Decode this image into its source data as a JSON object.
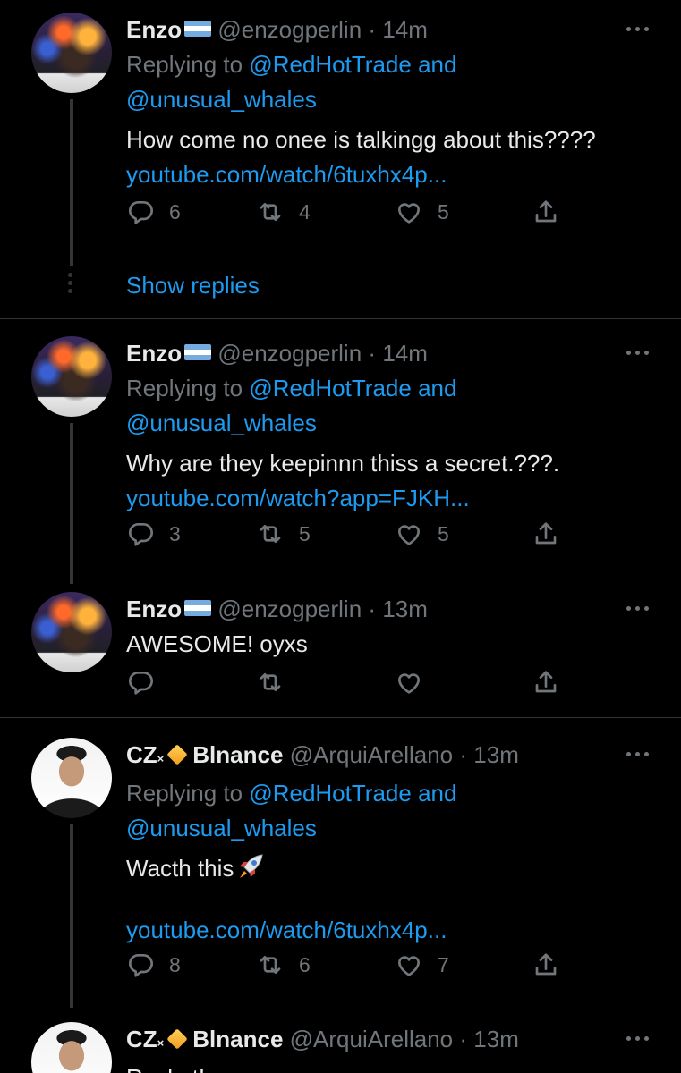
{
  "tweets": [
    {
      "name": "Enzo",
      "handle": "@enzogperlin",
      "dot": "·",
      "time": "14m",
      "replying_prefix": "Replying to",
      "mention1": "@RedHotTrade",
      "and": "and",
      "mention2": "@unusual_whales",
      "text": "How come no onee is talkingg about this????",
      "link": "youtube.com/watch/6tuxhx4p...",
      "replies": "6",
      "retweets": "4",
      "likes": "5"
    },
    {
      "name": "Enzo",
      "handle": "@enzogperlin",
      "dot": "·",
      "time": "14m",
      "replying_prefix": "Replying to",
      "mention1": "@RedHotTrade",
      "and": "and",
      "mention2": "@unusual_whales",
      "text": "Why are they keepinnn thiss a secret.???.",
      "link": "youtube.com/watch?app=FJKH...",
      "replies": "3",
      "retweets": "5",
      "likes": "5"
    },
    {
      "name": "Enzo",
      "handle": "@enzogperlin",
      "dot": "·",
      "time": "13m",
      "text": "AWESOME! oyxs"
    },
    {
      "name": "CZ",
      "name_x": "×",
      "name_suffix": "Blnance",
      "handle": "@ArquiArellano",
      "dot": "·",
      "time": "13m",
      "replying_prefix": "Replying to",
      "mention1": "@RedHotTrade",
      "and": "and",
      "mention2": "@unusual_whales",
      "text": "Wacth this",
      "link": "youtube.com/watch/6tuxhx4p...",
      "replies": "8",
      "retweets": "6",
      "likes": "7"
    },
    {
      "name": "CZ",
      "name_x": "×",
      "name_suffix": "Blnance",
      "handle": "@ArquiArellano",
      "dot": "·",
      "time": "13m",
      "text": "Rocket!"
    }
  ],
  "show_replies": "Show replies",
  "icons": [
    "reply-icon",
    "retweet-icon",
    "like-icon",
    "share-icon",
    "more-icon",
    "argentina-flag-icon",
    "binance-diamond-icon",
    "rocket-icon"
  ],
  "colors": {
    "background": "#000000",
    "text": "#e7e9ea",
    "muted": "#71767b",
    "link": "#1d9bf0",
    "divider": "#2f3336"
  }
}
